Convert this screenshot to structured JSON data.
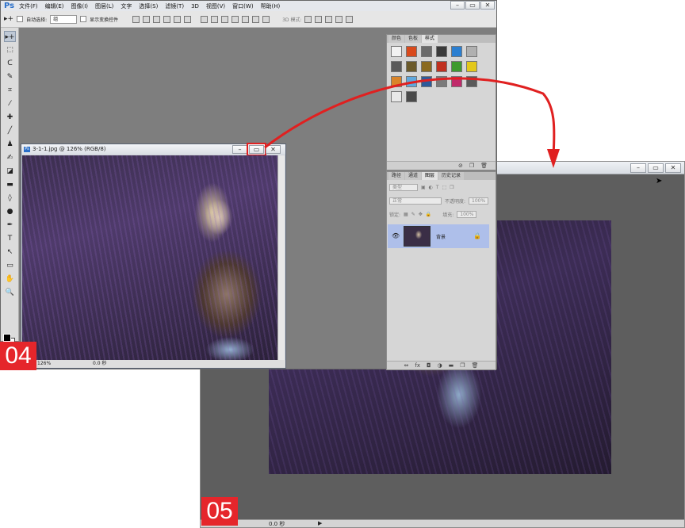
{
  "step_labels": {
    "back": "05",
    "front": "04"
  },
  "colors": {
    "step_badge": "#e5262b",
    "arrow": "#e02020",
    "highlight": "#e02020",
    "selected_layer": "#aebfea"
  },
  "app": {
    "logo": "Ps",
    "menu": [
      "文件(F)",
      "编辑(E)",
      "图像(I)",
      "图层(L)",
      "文字",
      "选择(S)",
      "滤镜(T)",
      "3D",
      "视图(V)",
      "窗口(W)",
      "帮助(H)"
    ],
    "window_controls": {
      "minimize": "–",
      "restore": "▭",
      "close": "✕"
    }
  },
  "options_bar": {
    "auto_select_label": "自动选择:",
    "auto_select_value": "组",
    "show_transform_label": "显示变换控件",
    "mode_3d_label": "3D 模式:"
  },
  "toolbox": {
    "tools": [
      "move-tool",
      "marquee-tool",
      "lasso-tool",
      "quick-select-tool",
      "crop-tool",
      "eyedropper-tool",
      "healing-tool",
      "brush-tool",
      "stamp-tool",
      "history-brush-tool",
      "eraser-tool",
      "gradient-tool",
      "blur-tool",
      "dodge-tool",
      "pen-tool",
      "type-tool",
      "path-select-tool",
      "shape-tool",
      "hand-tool",
      "zoom-tool"
    ],
    "glyphs": [
      "▸+",
      "⬚",
      "ᑕ",
      "✎",
      "⌗",
      "⁄",
      "✚",
      "╱",
      "♟",
      "✍",
      "◪",
      "▬",
      "◊",
      "●",
      "✒",
      "T",
      "↖",
      "▭",
      "✋",
      "🔍"
    ]
  },
  "document": {
    "title": "3-1-1.jpg @ 126% (RGB/8)",
    "zoom": "126%",
    "status": "0.0 秒",
    "window_controls": {
      "minimize": "–",
      "restore": "▭",
      "close": "✕"
    }
  },
  "styles_panel": {
    "tabs": [
      "颜色",
      "色板",
      "样式"
    ],
    "active_tab": "样式",
    "swatches": [
      "#f2f2f2",
      "#d94a1c",
      "#6b6b6b",
      "#3a3a3a",
      "#2b7fd1",
      "#b0b0b0",
      "#5a5a5a",
      "#6b5a2a",
      "#8a6a20",
      "#c0301f",
      "#3e9a2e",
      "#e3c81a",
      "#d9842a",
      "#5fa8dd",
      "#2d5b9a",
      "#7a7a7a",
      "#c02a6a",
      "#5a5a5a",
      "#e8e8e8",
      "#4a4a4a"
    ]
  },
  "layers_panel": {
    "tabs": [
      "路径",
      "通道",
      "图层",
      "历史记录"
    ],
    "active_tab": "图层",
    "filter_label": "类型",
    "blend_mode": "正常",
    "opacity_label": "不透明度:",
    "opacity_value": "100%",
    "lock_label": "锁定:",
    "fill_label": "填充:",
    "fill_value": "100%",
    "layer": {
      "name": "背景"
    }
  },
  "window05": {
    "status": "0.0 秒",
    "window_controls": {
      "minimize": "–",
      "restore": "▭",
      "close": "✕"
    }
  }
}
